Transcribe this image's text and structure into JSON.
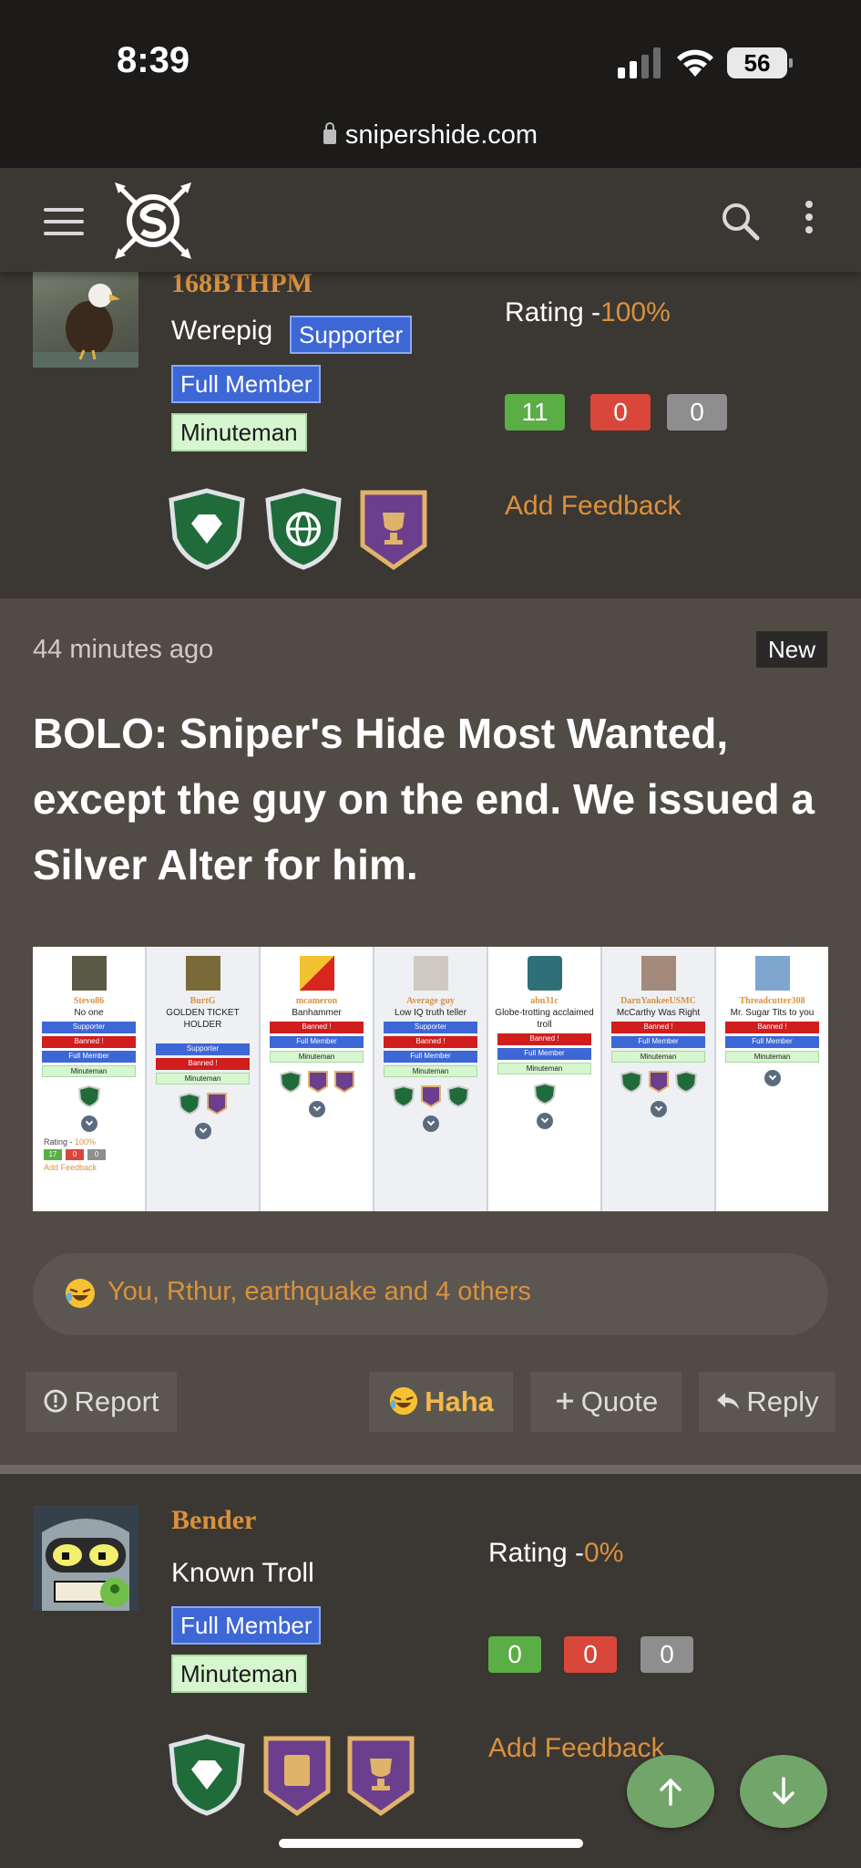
{
  "status": {
    "time": "8:39",
    "battery": "56"
  },
  "url": "snipershide.com",
  "user1": {
    "name": "168BTHPM",
    "title": "Werepig",
    "badges": [
      "Supporter",
      "Full Member",
      "Minuteman"
    ],
    "rating_label": "Rating -",
    "rating_pct": "100%",
    "feedback": {
      "positive": "11",
      "negative": "0",
      "neutral": "0"
    },
    "add_feedback": "Add Feedback"
  },
  "post": {
    "time": "44 minutes ago",
    "new_label": "New",
    "text": "BOLO: Sniper's Hide Most Wanted, except the guy on the end. We issued a Silver Alter for him.",
    "image_users": [
      {
        "name": "Stevo86",
        "title": "No one",
        "badges": [
          "Supporter",
          "Banned !",
          "Full Member",
          "Minuteman"
        ]
      },
      {
        "name": "BurtG",
        "title": "GOLDEN TICKET HOLDER",
        "badges": [
          "Supporter",
          "Banned !",
          "Minuteman"
        ]
      },
      {
        "name": "mcameron",
        "title": "Banhammer",
        "badges": [
          "Banned !",
          "Full Member",
          "Minuteman"
        ]
      },
      {
        "name": "Average guy",
        "title": "Low IQ truth teller",
        "badges": [
          "Supporter",
          "Banned !",
          "Full Member",
          "Minuteman"
        ]
      },
      {
        "name": "abn31c",
        "title": "Globe-trotting acclaimed troll",
        "badges": [
          "Banned !",
          "Full Member",
          "Minuteman"
        ]
      },
      {
        "name": "DarnYankeeUSMC",
        "title": "McCarthy Was Right",
        "badges": [
          "Banned !",
          "Full Member",
          "Minuteman"
        ]
      },
      {
        "name": "Threadcutter308",
        "title": "Mr. Sugar Tits to you",
        "badges": [
          "Banned !",
          "Full Member",
          "Minuteman"
        ]
      }
    ],
    "image_rating": {
      "label": "Rating - ",
      "pct": "100%",
      "feedback": [
        "17",
        "0",
        "0"
      ],
      "add_feedback": "Add Feedback"
    },
    "reactions": "You, Rthur, earthquake and 4 others",
    "actions": {
      "report": "Report",
      "haha": "Haha",
      "quote": "Quote",
      "reply": "Reply"
    }
  },
  "user2": {
    "name": "Bender",
    "title": "Known Troll",
    "badges": [
      "Full Member",
      "Minuteman"
    ],
    "rating_label": "Rating -",
    "rating_pct": "0%",
    "feedback": {
      "positive": "0",
      "negative": "0",
      "neutral": "0"
    },
    "add_feedback": "Add Feedback"
  },
  "colors": {
    "accent": "#d9913d",
    "bg": "#3b3733",
    "post_bg": "#514b45",
    "badge_blue": "#3e67d6",
    "badge_green": "#d6f6cf"
  }
}
